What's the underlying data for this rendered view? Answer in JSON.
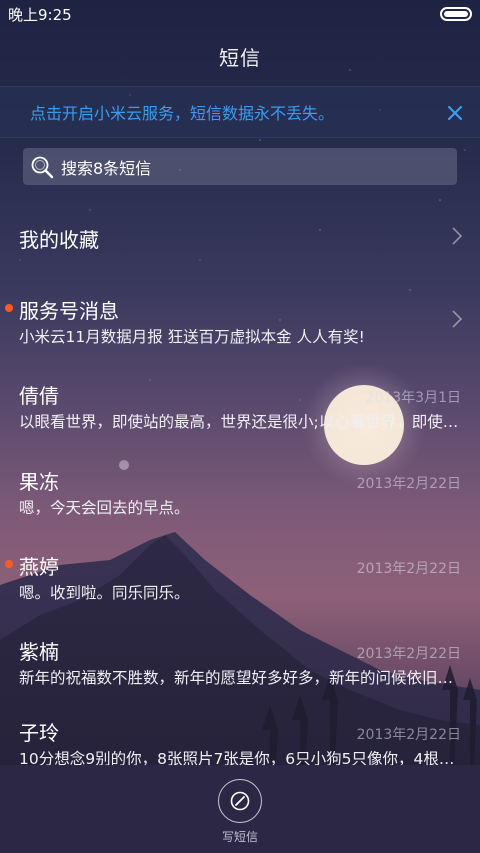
{
  "status_bar": {
    "time": "晚上9:25"
  },
  "header": {
    "title": "短信"
  },
  "banner": {
    "text": "点击开启小米云服务，短信数据永不丢失。"
  },
  "search": {
    "placeholder": "搜索8条短信"
  },
  "favorites": {
    "label": "我的收藏"
  },
  "conversations": [
    {
      "name": "服务号消息",
      "preview": "小米云11月数据月报 狂送百万虚拟本金 人人有奖!",
      "date": "",
      "unread": true
    },
    {
      "name": "倩倩",
      "preview": "以眼看世界，即使站的最高，世界还是很小;以心看世界，即使…",
      "date": "2013年3月1日",
      "unread": false
    },
    {
      "name": "果冻",
      "preview": "嗯，今天会回去的早点。",
      "date": "2013年2月22日",
      "unread": false
    },
    {
      "name": "燕婷",
      "preview": "嗯。收到啦。同乐同乐。",
      "date": "2013年2月22日",
      "unread": true
    },
    {
      "name": "紫楠",
      "preview": "新年的祝福数不胜数，新年的愿望好多好多，新年的问候依旧…",
      "date": "2013年2月22日",
      "unread": false
    },
    {
      "name": "子玲",
      "preview": "10分想念9别的你，8张照片7张是你，6只小狗5只像你，4根…",
      "date": "2013年2月22日",
      "unread": false
    }
  ],
  "compose": {
    "label": "写短信"
  },
  "colors": {
    "accent": "#3a9df0",
    "unread_dot": "#ff5a1f"
  },
  "icons": {
    "banner_close": "close-icon",
    "search": "search-icon",
    "chevron": "chevron-right-icon",
    "compose": "compose-icon"
  }
}
